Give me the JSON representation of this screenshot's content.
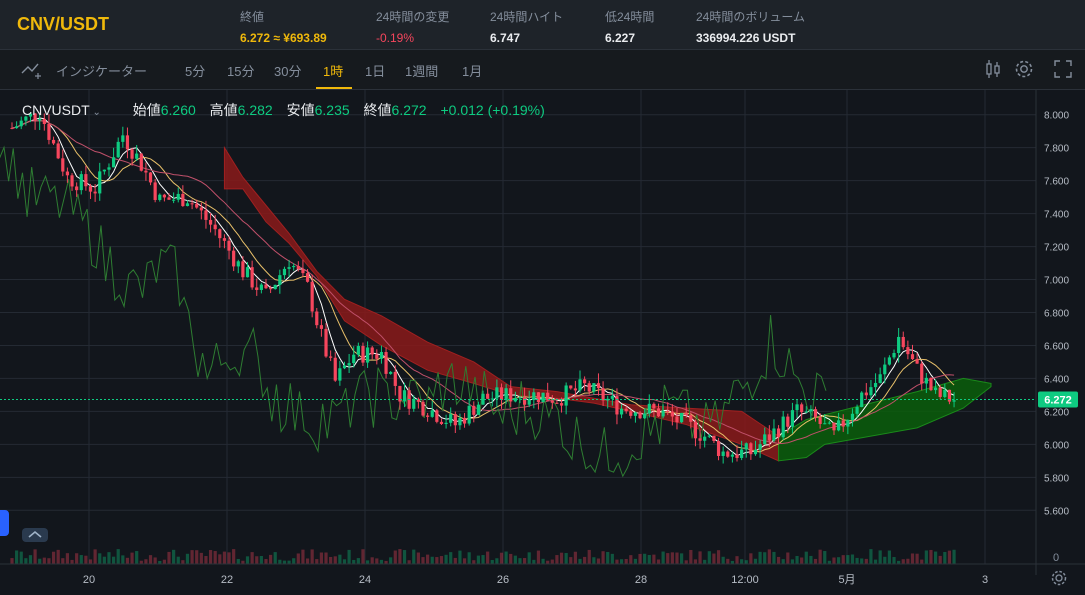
{
  "header": {
    "pair": "CNV/USDT",
    "stats": [
      {
        "label": "終値",
        "value": "6.272 ≈ ¥693.89",
        "color": "#f0b90b"
      },
      {
        "label": "24時間の変更",
        "value": "-0.19%",
        "color": "#f6465d"
      },
      {
        "label": "24時間ハイト",
        "value": "6.747",
        "color": "#eaecef"
      },
      {
        "label": "低24時間",
        "value": "6.227",
        "color": "#eaecef"
      },
      {
        "label": "24時間のボリューム",
        "value": "336994.226 USDT",
        "color": "#eaecef"
      }
    ]
  },
  "toolbar": {
    "indicators_label": "インジケーター",
    "intervals": [
      "5分",
      "15分",
      "30分",
      "1時",
      "1日",
      "1週間",
      "1月"
    ],
    "active_interval": "1時",
    "icons": [
      "candle-type-icon",
      "gear-icon",
      "fullscreen-icon"
    ]
  },
  "legend": {
    "symbol": "CNVUSDT",
    "open_label": "始値",
    "open": "6.260",
    "high_label": "高値",
    "high": "6.282",
    "low_label": "安値",
    "low": "6.235",
    "close_label": "終値",
    "close": "6.272",
    "change": "+0.012 (+0.19%)"
  },
  "colors": {
    "up": "#0ecb81",
    "down": "#f6465d",
    "accent": "#f0b90b",
    "cloud_bear": "#8b1a1a",
    "cloud_bull": "#0a5e0a"
  },
  "chart_data": {
    "type": "candlestick",
    "x_ticks": [
      "20",
      "22",
      "24",
      "26",
      "28",
      "12:00",
      "5月",
      "3"
    ],
    "y_ticks": [
      "8.000",
      "7.800",
      "7.600",
      "7.400",
      "7.200",
      "7.000",
      "6.800",
      "6.600",
      "6.400",
      "6.200",
      "6.000",
      "5.800",
      "5.600"
    ],
    "ylim": [
      5.45,
      8.15
    ],
    "volume_tick": "0",
    "last_price": "6.272",
    "price_path": [
      [
        0,
        7.92
      ],
      [
        6,
        8.02
      ],
      [
        12,
        7.62
      ],
      [
        18,
        7.55
      ],
      [
        24,
        7.88
      ],
      [
        28,
        7.7
      ],
      [
        32,
        7.48
      ],
      [
        38,
        7.5
      ],
      [
        44,
        7.3
      ],
      [
        50,
        7.05
      ],
      [
        55,
        6.9
      ],
      [
        60,
        7.12
      ],
      [
        64,
        6.95
      ],
      [
        67,
        6.65
      ],
      [
        70,
        6.38
      ],
      [
        74,
        6.55
      ],
      [
        80,
        6.55
      ],
      [
        84,
        6.3
      ],
      [
        90,
        6.22
      ],
      [
        96,
        6.12
      ],
      [
        102,
        6.28
      ],
      [
        108,
        6.3
      ],
      [
        114,
        6.3
      ],
      [
        118,
        6.28
      ],
      [
        124,
        6.35
      ],
      [
        132,
        6.22
      ],
      [
        140,
        6.2
      ],
      [
        146,
        6.12
      ],
      [
        150,
        6.05
      ],
      [
        154,
        5.95
      ],
      [
        160,
        5.95
      ],
      [
        164,
        6.05
      ],
      [
        170,
        6.2
      ],
      [
        174,
        6.15
      ],
      [
        178,
        6.05
      ],
      [
        184,
        6.3
      ],
      [
        188,
        6.4
      ],
      [
        192,
        6.65
      ],
      [
        196,
        6.45
      ],
      [
        200,
        6.3
      ],
      [
        204,
        6.27
      ]
    ],
    "ichimoku_cloud": {
      "top": [
        [
          46,
          7.8
        ],
        [
          50,
          7.62
        ],
        [
          55,
          7.45
        ],
        [
          60,
          7.28
        ],
        [
          66,
          7.05
        ],
        [
          72,
          6.88
        ],
        [
          80,
          6.78
        ],
        [
          90,
          6.62
        ],
        [
          100,
          6.5
        ],
        [
          108,
          6.35
        ],
        [
          118,
          6.32
        ],
        [
          126,
          6.28
        ],
        [
          134,
          6.24
        ],
        [
          146,
          6.22
        ],
        [
          158,
          6.2
        ],
        [
          166,
          6.05
        ],
        [
          172,
          6.15
        ],
        [
          176,
          6.18
        ],
        [
          186,
          6.25
        ],
        [
          196,
          6.32
        ],
        [
          206,
          6.4
        ],
        [
          212,
          6.37
        ]
      ],
      "bottom": [
        [
          46,
          7.55
        ],
        [
          50,
          7.55
        ],
        [
          55,
          7.35
        ],
        [
          60,
          7.22
        ],
        [
          66,
          7.02
        ],
        [
          72,
          6.75
        ],
        [
          80,
          6.6
        ],
        [
          90,
          6.45
        ],
        [
          100,
          6.37
        ],
        [
          108,
          6.3
        ],
        [
          118,
          6.28
        ],
        [
          126,
          6.25
        ],
        [
          134,
          6.2
        ],
        [
          146,
          6.12
        ],
        [
          158,
          6.0
        ],
        [
          166,
          5.9
        ],
        [
          172,
          5.92
        ],
        [
          176,
          6.0
        ],
        [
          186,
          6.05
        ],
        [
          196,
          6.1
        ],
        [
          206,
          6.22
        ],
        [
          212,
          6.35
        ]
      ]
    }
  }
}
